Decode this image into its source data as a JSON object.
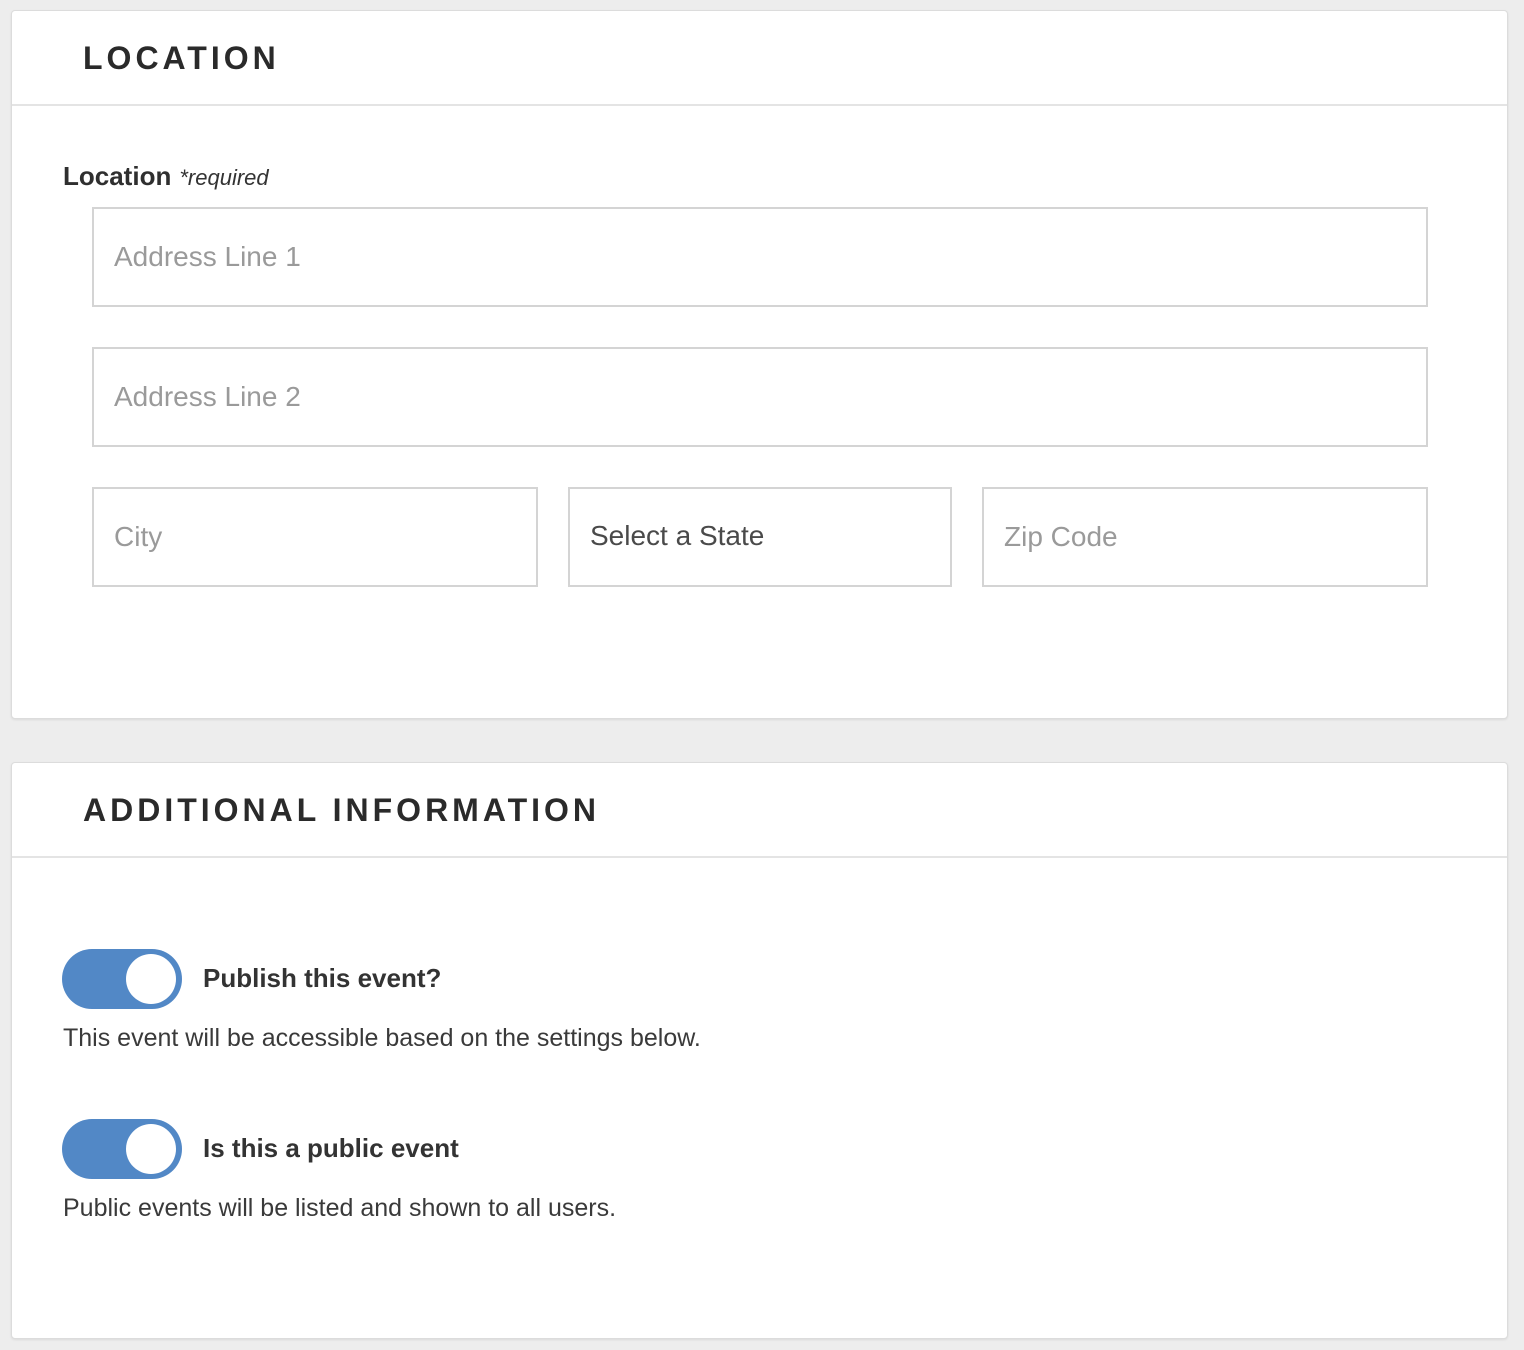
{
  "location_section": {
    "title": "LOCATION",
    "field_label": "Location",
    "required_text": "*required",
    "address_line_1": {
      "placeholder": "Address Line 1",
      "value": ""
    },
    "address_line_2": {
      "placeholder": "Address Line 2",
      "value": ""
    },
    "city": {
      "placeholder": "City",
      "value": ""
    },
    "state": {
      "selected": "Select a State"
    },
    "zip": {
      "placeholder": "Zip Code",
      "value": ""
    }
  },
  "additional_section": {
    "title": "ADDITIONAL INFORMATION",
    "publish": {
      "label": "Publish this event?",
      "help": "This event will be accessible based on the settings below.",
      "enabled": true
    },
    "public": {
      "label": "Is this a public event",
      "help": "Public events will be listed and shown to all users.",
      "enabled": true
    }
  },
  "colors": {
    "toggle_on": "#5288c6",
    "background": "#ededed",
    "card": "#ffffff",
    "border": "#d4d4d4"
  }
}
